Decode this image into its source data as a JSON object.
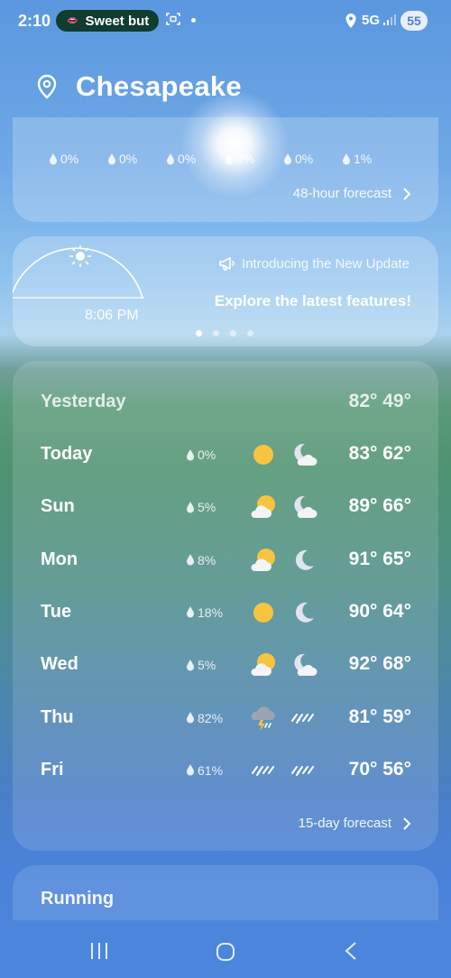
{
  "status_bar": {
    "time": "2:10",
    "notification_pill": "Sweet but",
    "network": "5G",
    "battery": "55"
  },
  "header": {
    "city": "Chesapeake"
  },
  "hourly_card": {
    "precip": [
      "0%",
      "0%",
      "0%",
      "0%",
      "0%",
      "1%"
    ],
    "forecast_link": "48-hour forecast"
  },
  "sun_promo_card": {
    "sunset_time": "8:06 PM",
    "promo_subtitle": "Introducing the New Update",
    "promo_title": "Explore the latest features!",
    "page_count": 4,
    "active_page": 0
  },
  "daily": {
    "yesterday": {
      "day": "Yesterday",
      "temps": "82° 49°"
    },
    "rows": [
      {
        "day": "Today",
        "precip": "0%",
        "day_icon": "sun-icon",
        "night_icon": "moon-cloud-icon",
        "temps": "83° 62°"
      },
      {
        "day": "Sun",
        "precip": "5%",
        "day_icon": "sun-cloud-icon",
        "night_icon": "moon-cloud-icon",
        "temps": "89° 66°"
      },
      {
        "day": "Mon",
        "precip": "8%",
        "day_icon": "sun-cloud-icon",
        "night_icon": "moon-icon",
        "temps": "91° 65°"
      },
      {
        "day": "Tue",
        "precip": "18%",
        "day_icon": "sun-icon",
        "night_icon": "moon-icon",
        "temps": "90° 64°"
      },
      {
        "day": "Wed",
        "precip": "5%",
        "day_icon": "sun-cloud-icon",
        "night_icon": "moon-cloud-icon",
        "temps": "92° 68°"
      },
      {
        "day": "Thu",
        "precip": "82%",
        "day_icon": "thunderstorm-icon",
        "night_icon": "rain-icon",
        "temps": "81° 59°"
      },
      {
        "day": "Fri",
        "precip": "61%",
        "day_icon": "rain-icon",
        "night_icon": "rain-icon",
        "temps": "70° 56°"
      }
    ],
    "forecast_link": "15-day forecast"
  },
  "running_card": {
    "title": "Running"
  },
  "colors": {
    "sun": "#f8c440",
    "status_pill": "#0f3d2e",
    "nav_bar": "#4c86dc"
  }
}
